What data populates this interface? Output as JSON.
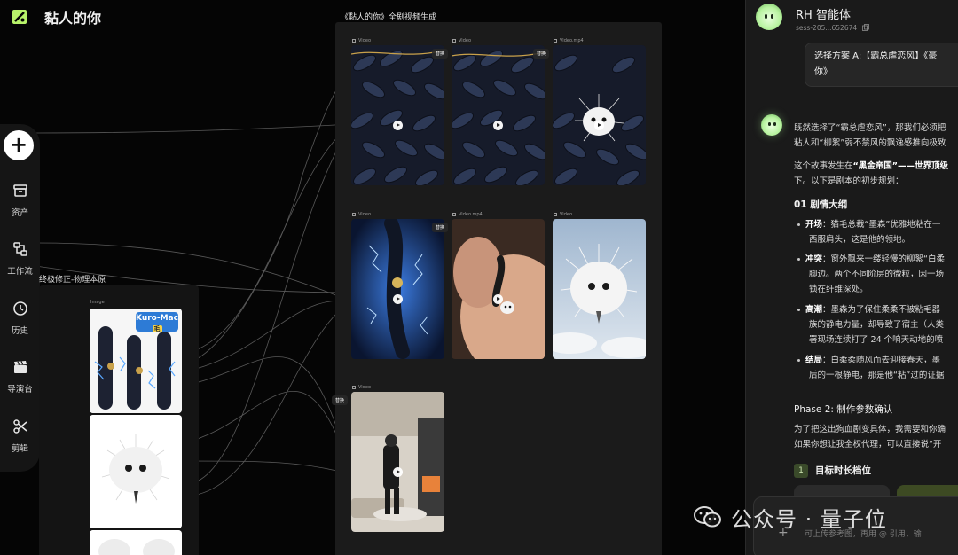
{
  "app": {
    "title": "黏人的你"
  },
  "toolbar": {
    "add_label": "+",
    "items": [
      {
        "label": "资产",
        "icon": "archive-icon"
      },
      {
        "label": "工作流",
        "icon": "workflow-icon"
      },
      {
        "label": "历史",
        "icon": "clock-icon"
      },
      {
        "label": "导演台",
        "icon": "clapperboard-icon"
      },
      {
        "label": "剪辑",
        "icon": "scissors-icon"
      }
    ]
  },
  "small_board": {
    "title": "终极修正-物理本原",
    "header": "Image",
    "logo_text": "Kuro-Mac",
    "logo_sub": "毛"
  },
  "main_board": {
    "title": "《黏人的你》全剧视频生成",
    "replace_label": "替换",
    "cells": [
      {
        "caption": "Video",
        "scene": "braid",
        "has_replace": false
      },
      {
        "caption": "Video",
        "scene": "braid",
        "has_replace": true
      },
      {
        "caption": "Video.mp4",
        "scene": "braid-puff",
        "has_replace": true
      },
      {
        "caption": "Video",
        "scene": "blue-lightning",
        "has_replace": false
      },
      {
        "caption": "Video.mp4",
        "scene": "hand",
        "has_replace": true
      },
      {
        "caption": "Video",
        "scene": "sky-puff",
        "has_replace": false
      },
      {
        "caption": "Video",
        "scene": "livingroom",
        "has_replace": true
      }
    ]
  },
  "panel": {
    "agent_name": "RH 智能体",
    "session_id": "sess-205...652674",
    "user_message_line1": "选择方案 A:【霸总虐恋风】《豪",
    "user_message_line2": "你》",
    "intro_line1_a": "既然选择了“霸总虐恋风”，那我们必须把",
    "intro_line2_a": "粘人和“柳絮”弱不禁风的飘逸感推向极致",
    "story_line1_a": "这个故事发生在",
    "story_line1_b": "“黑金帝国”——世界顶级",
    "story_line2": "下。以下是剧本的初步规划：",
    "outline_title": "01 剧情大纲",
    "bullets": [
      {
        "label": "开场",
        "line1": "：猫毛总裁“墨森”优雅地粘在一",
        "line2": "西服肩头，这是他的领地。"
      },
      {
        "label": "冲突",
        "line1": "：窗外飘来一缕轻慢的柳絮“白柔",
        "line2": "脚边。两个不同阶层的微粒，因一场",
        "line3": "锁在纤维深处。"
      },
      {
        "label": "高潮",
        "line1": "：墨森为了保住柔柔不被粘毛器",
        "line2": "族的静电力量，却导致了宿主（人类",
        "line3": "署现场连续打了 24 个响天动地的喷"
      },
      {
        "label": "结局",
        "line1": "：白柔柔随风而去迎接春天，墨",
        "line2": "后的一根静电，那是他“粘”过的证据"
      }
    ],
    "phase_title": "Phase 2: 制作参数确认",
    "phase_line1": "为了把这出狗血剧变具体，我需要和你确",
    "phase_line2": "如果你想让我全权代理，可以直接说“开",
    "step_number": "1",
    "step_label": "目标时长档位",
    "input_plus": "+",
    "input_placeholder": "可上传参考图，再用 @ 引用，输"
  },
  "watermark": {
    "text": "公众号 · 量子位",
    "icon": "wechat-icon"
  }
}
